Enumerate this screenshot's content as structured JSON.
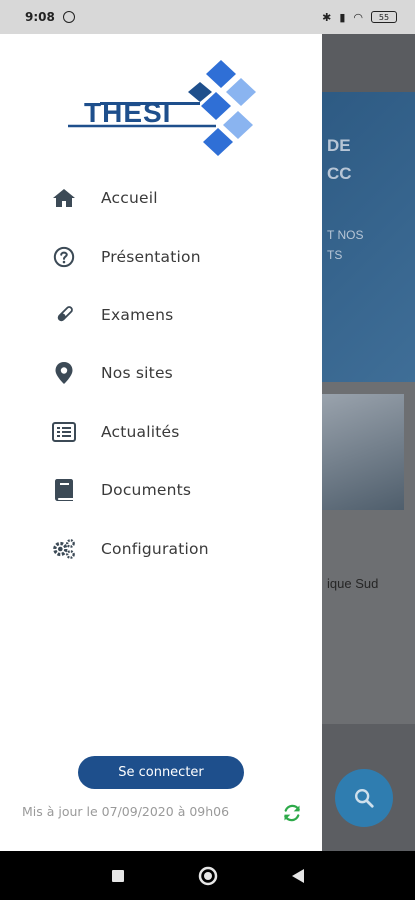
{
  "status_bar": {
    "time": "9:08",
    "battery": "55"
  },
  "app": {
    "logo_text": "THESI",
    "brand_color": "#1e4f8c",
    "logo_accent": "#2f6fd6"
  },
  "menu": {
    "items": [
      {
        "label": "Accueil",
        "icon": "home-icon"
      },
      {
        "label": "Présentation",
        "icon": "question-circle-icon"
      },
      {
        "label": "Examens",
        "icon": "test-tube-icon"
      },
      {
        "label": "Nos sites",
        "icon": "map-pin-icon"
      },
      {
        "label": "Actualités",
        "icon": "newspaper-icon"
      },
      {
        "label": "Documents",
        "icon": "book-icon"
      },
      {
        "label": "Configuration",
        "icon": "gears-icon"
      }
    ]
  },
  "footer": {
    "connect_label": "Se connecter",
    "updated_text": "Mis à jour le 07/09/2020 à 09h06",
    "refresh_color": "#2eaa4a"
  },
  "background": {
    "hero_line1": "DE",
    "hero_line2": "CC",
    "hero_line3": "T NOS",
    "hero_line4": "TS",
    "sud_text": "ique Sud"
  }
}
